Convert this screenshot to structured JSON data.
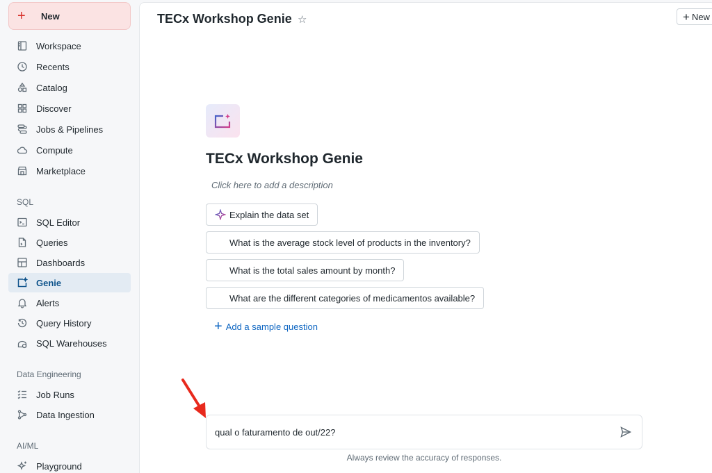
{
  "sidebar": {
    "new_label": "New",
    "items": [
      {
        "label": "Workspace",
        "icon": "workspace-icon"
      },
      {
        "label": "Recents",
        "icon": "clock-icon"
      },
      {
        "label": "Catalog",
        "icon": "catalog-icon"
      },
      {
        "label": "Discover",
        "icon": "grid-icon"
      },
      {
        "label": "Jobs & Pipelines",
        "icon": "workflow-icon"
      },
      {
        "label": "Compute",
        "icon": "cloud-icon"
      },
      {
        "label": "Marketplace",
        "icon": "store-icon"
      }
    ],
    "sql_section": "SQL",
    "sql_items": [
      {
        "label": "SQL Editor",
        "icon": "terminal-icon"
      },
      {
        "label": "Queries",
        "icon": "query-file-icon"
      },
      {
        "label": "Dashboards",
        "icon": "dashboard-icon"
      },
      {
        "label": "Genie",
        "icon": "genie-icon",
        "active": true
      },
      {
        "label": "Alerts",
        "icon": "bell-icon"
      },
      {
        "label": "Query History",
        "icon": "history-icon"
      },
      {
        "label": "SQL Warehouses",
        "icon": "warehouse-icon"
      }
    ],
    "de_section": "Data Engineering",
    "de_items": [
      {
        "label": "Job Runs",
        "icon": "list-check-icon"
      },
      {
        "label": "Data Ingestion",
        "icon": "ingestion-icon"
      }
    ],
    "ai_section": "AI/ML",
    "ai_items": [
      {
        "label": "Playground",
        "icon": "sparkle-icon"
      }
    ]
  },
  "header": {
    "title": "TECx Workshop Genie",
    "new_button": "New"
  },
  "space": {
    "title": "TECx Workshop Genie",
    "description_placeholder": "Click here to add a description",
    "explain_label": "Explain the data set",
    "sample_questions": [
      "What is the average stock level of products in the inventory?",
      "What is the total sales amount by month?",
      "What are the different categories of medicamentos available?"
    ],
    "add_question_label": "Add a sample question"
  },
  "chat": {
    "input_value": "qual o faturamento de out/22?",
    "disclaimer": "Always review the accuracy of responses."
  },
  "colors": {
    "accent": "#0e538b",
    "link": "#0e66c2",
    "new_button_bg": "#fbe3e3",
    "annotation_arrow": "#e8291c"
  }
}
